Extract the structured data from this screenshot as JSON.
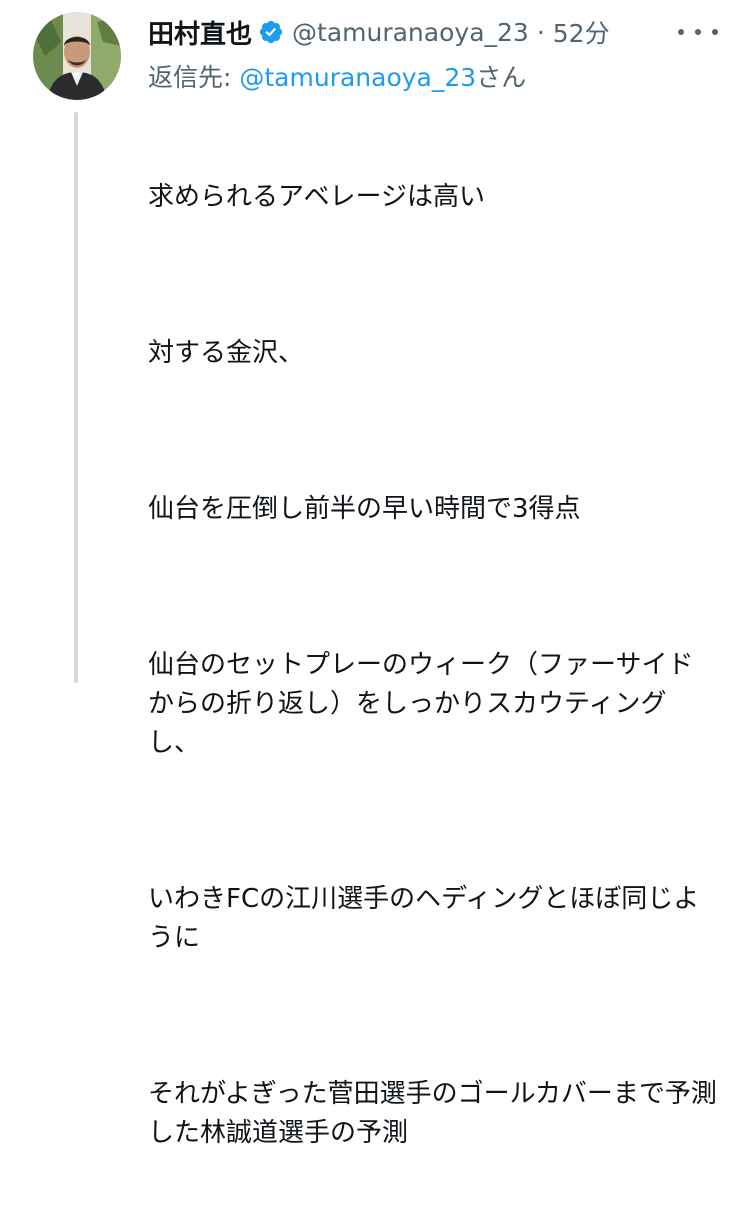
{
  "tweet": {
    "author_name": "田村直也",
    "verified_icon": "verified-badge-icon",
    "handle": "@tamuranaoya_23",
    "separator": "·",
    "time": "52分",
    "reply_prefix": "返信先: ",
    "reply_handle": "@tamuranaoya_23",
    "reply_suffix": "さん",
    "paragraphs": [
      "求められるアベレージは高い",
      "対する金沢、",
      "仙台を圧倒し前半の早い時間で3得点",
      "仙台のセットプレーのウィーク（ファーサイドからの折り返し）をしっかりスカウティングし、",
      "いわきFCの江川選手のヘディングとほぼ同じように",
      "それがよぎった菅田選手のゴールカバーまで予測した林誠道選手の予測"
    ]
  },
  "colors": {
    "text": "#0f1419",
    "muted": "#536471",
    "link": "#1d9bf0",
    "thread_line": "#cfd9de",
    "verified": "#1d9bf0"
  }
}
